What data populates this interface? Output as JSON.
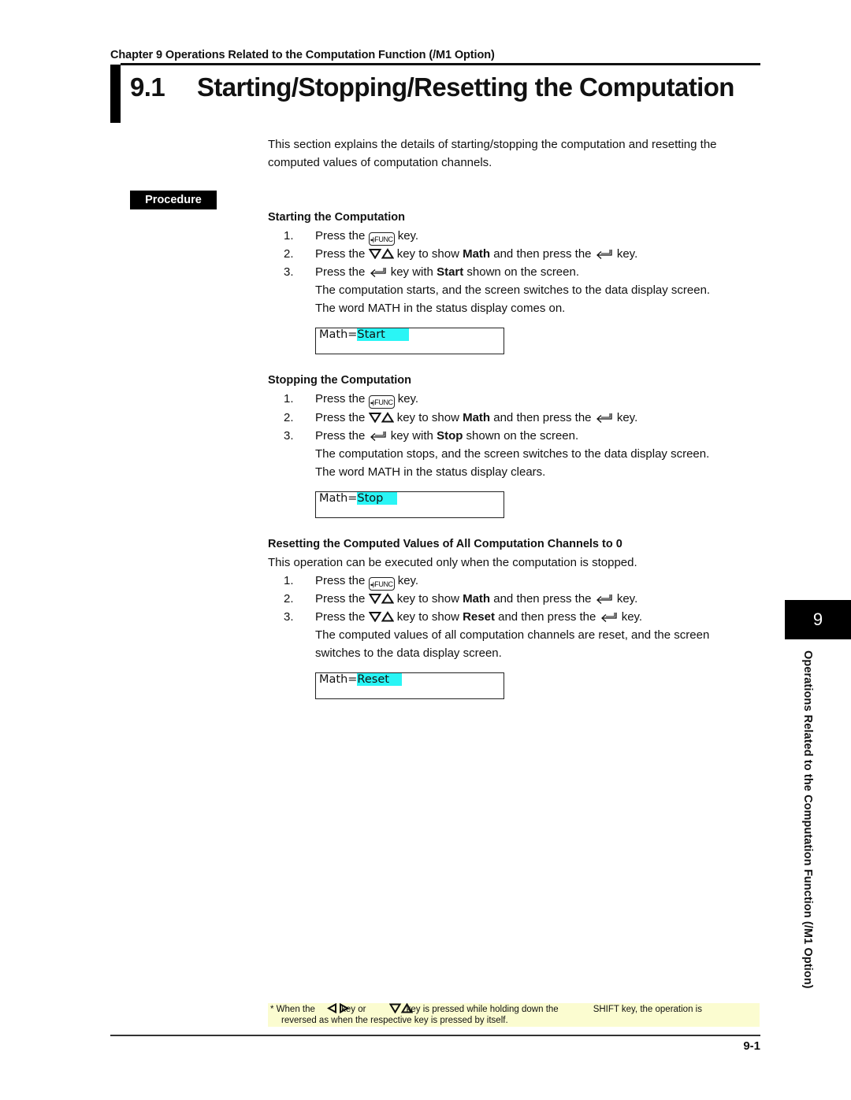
{
  "header": {
    "chapter": "Chapter 9  Operations Related to the Computation Function (/M1 Option)",
    "section_number": "9.1",
    "section_title": "Starting/Stopping/Resetting the Computation"
  },
  "intro": {
    "line1": "This section explains the details of starting/stopping the computation and resetting the",
    "line2": "computed values of computation channels."
  },
  "procedure_label": "Procedure",
  "keys": {
    "func": "FUNC",
    "func_icon": "speaker-func-key-icon",
    "updown_icon": "down-up-triangle-keys-icon",
    "enter_icon": "enter-arrow-key-icon"
  },
  "starting": {
    "heading": "Starting the Computation",
    "step1": {
      "num": "1.",
      "pre": "Press the ",
      "post": " key."
    },
    "step2": {
      "num": "2.",
      "pre": "Press the ",
      "mid1": " key to show ",
      "bold": "Math",
      "mid2": " and then press the ",
      "post": " key."
    },
    "step3": {
      "num": "3.",
      "pre": "Press the ",
      "mid1": " key with ",
      "bold": "Start",
      "post": " shown on the screen."
    },
    "result1": "The computation starts, and the screen switches to the data display screen.",
    "result2": "The word MATH in the status display comes on.",
    "lcd_prefix": "Math=",
    "lcd_value": "Start"
  },
  "stopping": {
    "heading": "Stopping the Computation",
    "step1": {
      "num": "1.",
      "pre": "Press the ",
      "post": " key."
    },
    "step2": {
      "num": "2.",
      "pre": "Press the ",
      "mid1": " key to show ",
      "bold": "Math",
      "mid2": " and then press the ",
      "post": " key."
    },
    "step3": {
      "num": "3.",
      "pre": "Press the ",
      "mid1": " key with ",
      "bold": "Stop",
      "post": " shown on the screen."
    },
    "result1": "The computation stops, and the screen switches to the data display screen.",
    "result2": "The word MATH in the status display clears.",
    "lcd_prefix": "Math=",
    "lcd_value": "Stop"
  },
  "resetting": {
    "heading": "Resetting the Computed Values of All Computation Channels to 0",
    "note": "This operation can be executed only when the computation is stopped.",
    "step1": {
      "num": "1.",
      "pre": "Press the ",
      "post": " key."
    },
    "step2": {
      "num": "2.",
      "pre": "Press the ",
      "mid1": " key to show ",
      "bold": "Math",
      "mid2": " and then press the ",
      "post": " key."
    },
    "step3": {
      "num": "3.",
      "pre": "Press the ",
      "mid1": " key to show ",
      "bold": "Reset",
      "mid2": " and then press the ",
      "post": " key."
    },
    "result1": "The computed values of all computation channels are reset, and the screen",
    "result2": "switches to the data display screen.",
    "lcd_prefix": "Math=",
    "lcd_value": "Reset"
  },
  "side_tab": {
    "number": "9",
    "text": "Operations Related to the Computation Function (/M1 Option)"
  },
  "footnote": {
    "star": "*",
    "a": " When the ",
    "b": "key or ",
    "c": "key is pressed while holding down the",
    "d": "SHIFT key, the operation is",
    "line2": "reversed as when the respective key is pressed by itself."
  },
  "page_number": "9-1",
  "colors": {
    "lcd_highlight": "#2af5f5",
    "footnote_bg": "#fbfcd0"
  }
}
